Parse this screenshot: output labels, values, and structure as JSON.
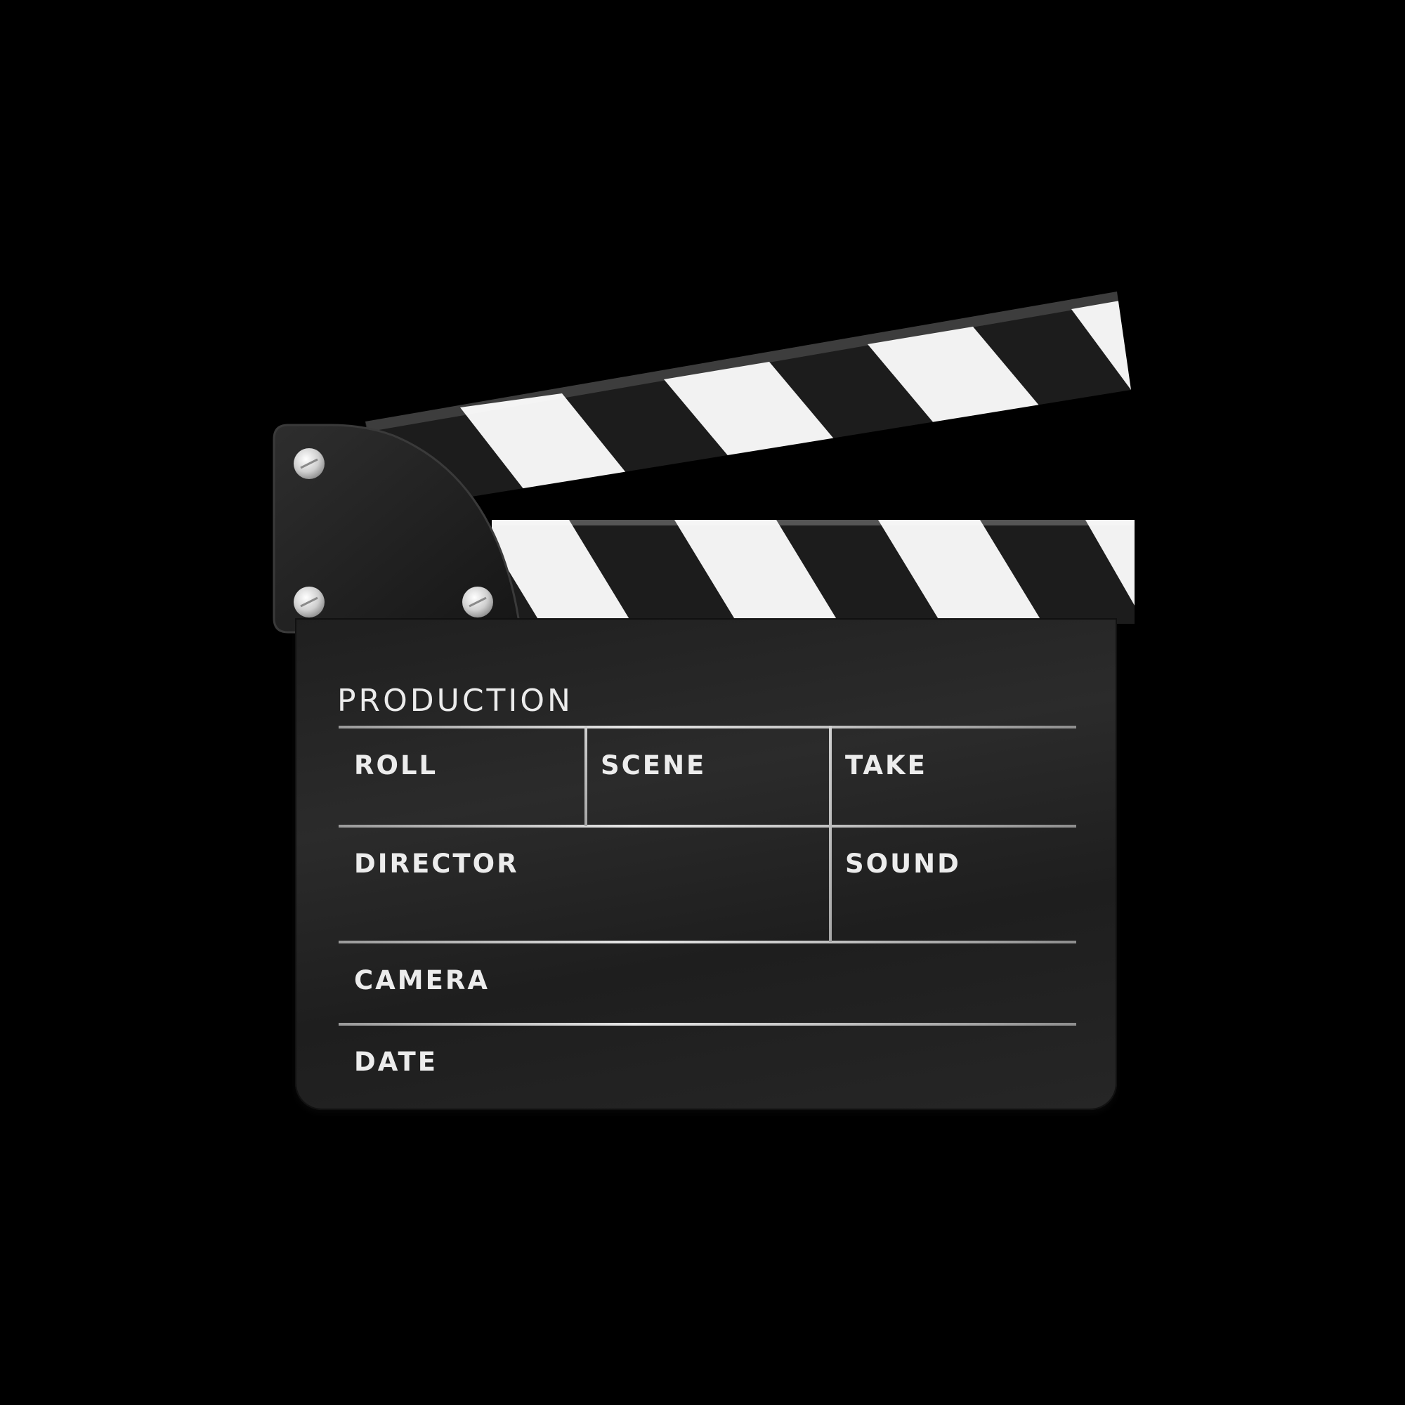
{
  "slate": {
    "production_label": "PRODUCTION",
    "fields": {
      "roll": "ROLL",
      "scene": "SCENE",
      "take": "TAKE",
      "director": "DIRECTOR",
      "sound": "SOUND",
      "camera": "CAMERA",
      "date": "DATE"
    }
  },
  "colors": {
    "background": "#000000",
    "board": "#262626",
    "stripe_dark": "#1c1c1c",
    "stripe_light": "#f2f2f2",
    "text": "#ececec"
  },
  "icons": {
    "hinge": "hinge-icon",
    "screw": "screw-icon"
  }
}
